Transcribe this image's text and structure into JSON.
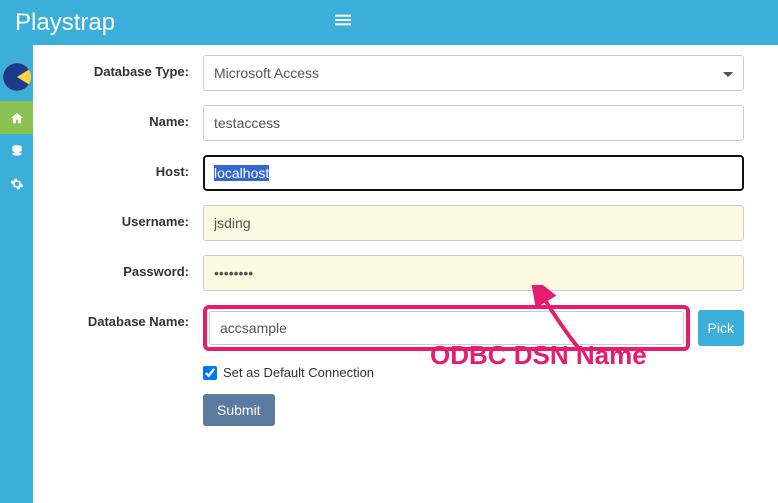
{
  "brand": "Playstrap",
  "form": {
    "dbtype_label": "Database Type:",
    "dbtype_value": "Microsoft Access",
    "name_label": "Name:",
    "name_value": "testaccess",
    "host_label": "Host:",
    "host_value": "localhost",
    "user_label": "Username:",
    "user_value": "jsding",
    "pwd_label": "Password:",
    "pwd_value": "••••••••",
    "dbname_label": "Database Name:",
    "dbname_value": "accsample",
    "pick_label": "Pick",
    "default_label": "Set as Default Connection",
    "submit_label": "Submit"
  },
  "annotation": "ODBC DSN Name",
  "colors": {
    "primary": "#3bafda",
    "accent": "#e51c6f",
    "sidebar_active": "#8cc152"
  }
}
